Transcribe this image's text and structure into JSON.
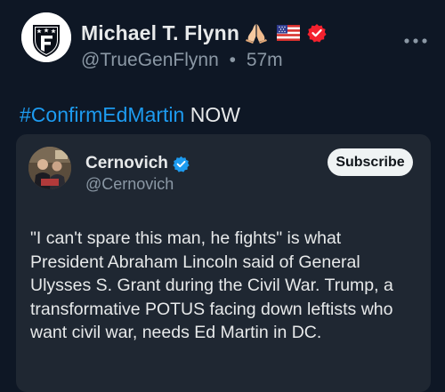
{
  "post": {
    "author_name": "Michael T. Flynn",
    "emoji_icons": [
      "folded-hands-icon",
      "us-flag-icon",
      "verified-badge-icon"
    ],
    "handle": "@TrueGenFlynn",
    "separator": "•",
    "time": "57m",
    "hashtag": "#ConfirmEdMartin",
    "text_after_hashtag": " NOW"
  },
  "quote": {
    "author_name": "Cernovich",
    "handle": "@Cernovich",
    "subscribe_label": "Subscribe",
    "body_lines": [
      "\"I can't spare this man, he fights\" is what",
      "President Abraham Lincoln said of General",
      "Ulysses S. Grant during the Civil War. Trump, a",
      "transformative POTUS facing down leftists who",
      "want civil war, needs Ed Martin in DC."
    ]
  },
  "colors": {
    "background": "#0e1725",
    "card": "#1f2732",
    "link": "#1d9bf0",
    "badge_red": "#f4212e",
    "verified_blue": "#1d9bf0"
  }
}
